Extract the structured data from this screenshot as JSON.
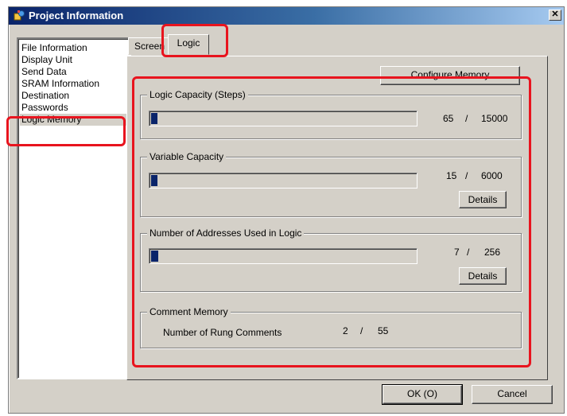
{
  "window": {
    "title": "Project Information",
    "close_glyph": "✕"
  },
  "nav": {
    "items": [
      {
        "label": "File Information"
      },
      {
        "label": "Display Unit"
      },
      {
        "label": "Send Data"
      },
      {
        "label": "SRAM Information"
      },
      {
        "label": "Destination"
      },
      {
        "label": "Passwords"
      },
      {
        "label": "Logic Memory",
        "selected": true
      }
    ]
  },
  "tabs": [
    {
      "label": "Screen"
    },
    {
      "label": "Logic",
      "active": true
    }
  ],
  "logic": {
    "configure_button": "Configure Memory",
    "logic_capacity": {
      "title": "Logic Capacity (Steps)",
      "used": "65",
      "sep": "/",
      "total": "15000",
      "fill_fraction": 0.004
    },
    "variable_capacity": {
      "title": "Variable Capacity",
      "used": "15",
      "sep": "/",
      "total": "6000",
      "details": "Details",
      "fill_fraction": 0.0025
    },
    "addresses": {
      "title": "Number of Addresses Used in Logic",
      "used": "7",
      "sep": "/",
      "total": "256",
      "details": "Details",
      "fill_fraction": 0.027
    },
    "comment_memory": {
      "title": "Comment Memory",
      "label": "Number of Rung Comments",
      "used": "2",
      "sep": "/",
      "total": "55"
    }
  },
  "footer": {
    "ok": "OK (O)",
    "cancel": "Cancel"
  },
  "colors": {
    "highlight": "#e8141e",
    "titlebar": "#0a246a",
    "progress": "#0a246a"
  }
}
